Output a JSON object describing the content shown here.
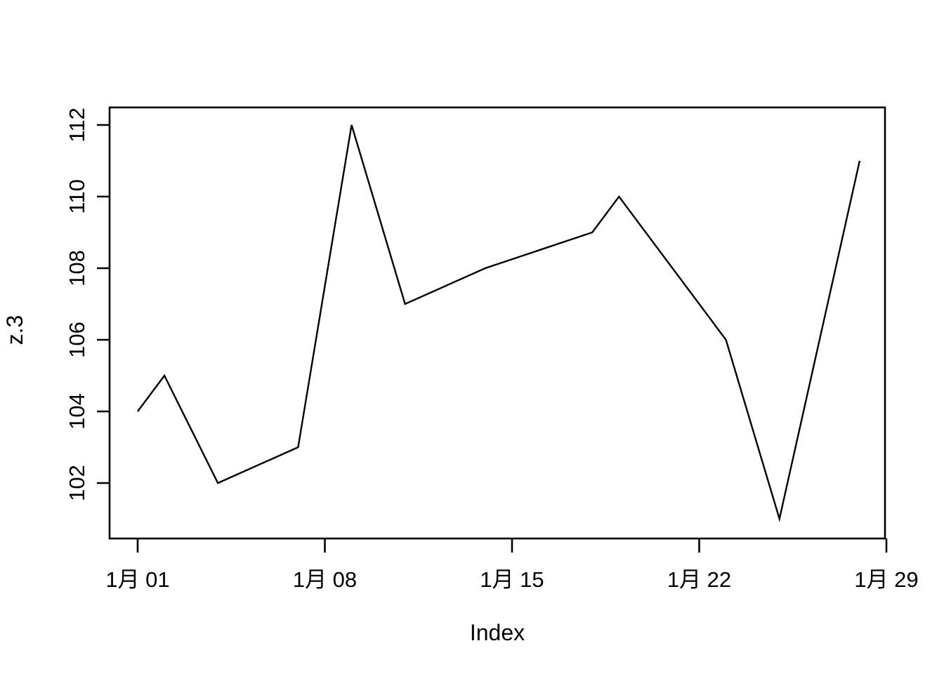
{
  "chart_data": {
    "type": "line",
    "title": "",
    "xlabel": "Index",
    "ylabel": "z.3",
    "x_tick_labels": [
      "1月 01",
      "1月 08",
      "1月 15",
      "1月 22",
      "1月 29"
    ],
    "x_tick_values": [
      1,
      8,
      15,
      22,
      29
    ],
    "y_tick_labels": [
      "102",
      "104",
      "106",
      "108",
      "110",
      "112"
    ],
    "y_tick_values": [
      102,
      104,
      106,
      108,
      110,
      112
    ],
    "xlim": [
      1,
      29
    ],
    "ylim": [
      100.6,
      112.3
    ],
    "grid": false,
    "legend": false,
    "line_color": "#000000",
    "background_color": "#ffffff",
    "x": [
      1,
      2,
      4,
      7,
      9,
      11,
      14,
      18,
      19,
      23,
      25,
      28
    ],
    "values": [
      104,
      105,
      102,
      103,
      112,
      107,
      108,
      109,
      110,
      106,
      101,
      111
    ],
    "points": [
      {
        "x": 1,
        "label": "1月 01",
        "y": 104
      },
      {
        "x": 2,
        "label": "1月 02",
        "y": 105
      },
      {
        "x": 4,
        "label": "1月 04",
        "y": 102
      },
      {
        "x": 7,
        "label": "1月 07",
        "y": 103
      },
      {
        "x": 9,
        "label": "1月 09",
        "y": 112
      },
      {
        "x": 11,
        "label": "1月 11",
        "y": 107
      },
      {
        "x": 14,
        "label": "1月 14",
        "y": 108
      },
      {
        "x": 18,
        "label": "1月 18",
        "y": 109
      },
      {
        "x": 19,
        "label": "1月 19",
        "y": 110
      },
      {
        "x": 23,
        "label": "1月 23",
        "y": 106
      },
      {
        "x": 25,
        "label": "1月 25",
        "y": 101
      },
      {
        "x": 28,
        "label": "1月 28",
        "y": 111
      }
    ]
  },
  "axes": {
    "y_label_text": "z.3",
    "x_label_text": "Index",
    "y_ticks": [
      {
        "value": 102,
        "label": "102"
      },
      {
        "value": 104,
        "label": "104"
      },
      {
        "value": 106,
        "label": "106"
      },
      {
        "value": 108,
        "label": "108"
      },
      {
        "value": 110,
        "label": "110"
      },
      {
        "value": 112,
        "label": "112"
      }
    ],
    "x_ticks": [
      {
        "value": 1,
        "label": "1月 01"
      },
      {
        "value": 8,
        "label": "1月 08"
      },
      {
        "value": 15,
        "label": "1月 15"
      },
      {
        "value": 22,
        "label": "1月 22"
      },
      {
        "value": 29,
        "label": "1月 29"
      }
    ]
  }
}
